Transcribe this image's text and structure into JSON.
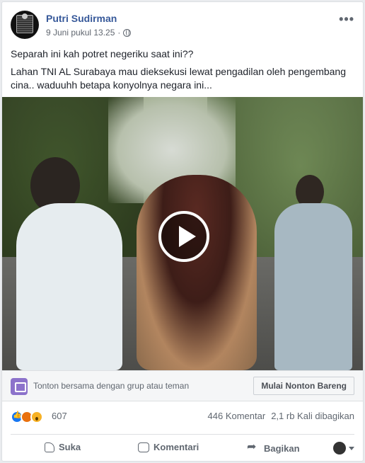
{
  "post": {
    "author": "Putri Sudirman",
    "timestamp": "9 Juni pukul 13.25",
    "privacy_icon": "globe-icon",
    "paragraphs": [
      "Separah ini kah potret negeriku saat ini??",
      "Lahan TNI AL Surabaya mau dieksekusi lewat pengadilan oleh pengembang cina.. waduuhh betapa konyolnya negara ini..."
    ]
  },
  "watch_party": {
    "text": "Tonton bersama dengan grup atau teman",
    "button": "Mulai Nonton Bareng"
  },
  "stats": {
    "reaction_count": "607",
    "comments": "446 Komentar",
    "shares": "2,1 rb Kali dibagikan"
  },
  "actions": {
    "like": "Suka",
    "comment": "Komentari",
    "share": "Bagikan"
  },
  "colors": {
    "link": "#365899",
    "watch_icon": "#8c72cb",
    "like": "#1877f2"
  }
}
